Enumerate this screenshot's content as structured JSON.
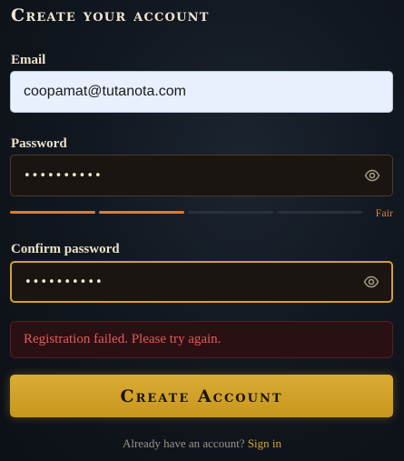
{
  "form": {
    "title": "Create your account",
    "email": {
      "label": "Email",
      "value": "coopamat@tutanota.com"
    },
    "password": {
      "label": "Password",
      "masked_value": "••••••••••",
      "strength_label": "Fair",
      "strength_level": 0.5,
      "strength_colors": [
        "#e47a2a",
        "#e47a2a",
        "#2a2f3a",
        "#2a2f3a"
      ]
    },
    "confirm_password": {
      "label": "Confirm password",
      "masked_value": "••••••••••"
    },
    "error_message": "Registration failed. Please try again.",
    "submit_label": "Create Account",
    "footer": {
      "prompt": "Already have an account?",
      "link": "Sign in"
    }
  },
  "colors": {
    "accent": "#d3a12d",
    "error": "#e25b5b",
    "strength_fair": "#d7802f"
  },
  "icons": {
    "password_toggle": "eye-icon"
  }
}
